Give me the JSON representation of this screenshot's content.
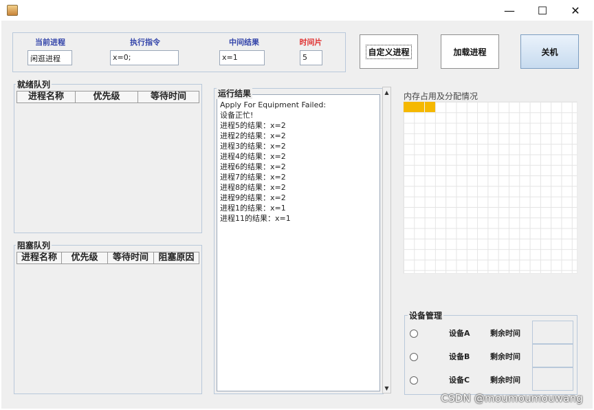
{
  "window": {
    "minimize_symbol": "—",
    "maximize_symbol": "☐",
    "close_symbol": "✕"
  },
  "top": {
    "current_process": {
      "label": "当前进程",
      "value": "闲逛进程"
    },
    "instruction": {
      "label": "执行指令",
      "value": "x=0;"
    },
    "intermediate": {
      "label": "中间结果",
      "value": "x=1"
    },
    "time_slice": {
      "label": "时间片",
      "value": "5"
    }
  },
  "colors": {
    "label_blue": "#3344aa",
    "label_red": "#e03030",
    "memory_used": "#f5b800"
  },
  "buttons": {
    "custom": "自定义进程",
    "load": "加载进程",
    "shutdown": "关机"
  },
  "ready_queue": {
    "title": "就绪队列",
    "columns": [
      "进程名称",
      "优先级",
      "等待时间"
    ]
  },
  "blocked_queue": {
    "title": "阻塞队列",
    "columns": [
      "进程名称",
      "优先级",
      "等待时间",
      "阻塞原因"
    ]
  },
  "run_results": {
    "title": "运行结果",
    "lines": [
      "Apply For Equipment Failed:",
      "设备正忙!",
      "进程5的结果：x=2",
      "进程2的结果：x=2",
      "进程3的结果：x=2",
      "进程4的结果：x=2",
      "进程6的结果：x=2",
      "进程7的结果：x=2",
      "进程8的结果：x=2",
      "进程9的结果：x=2",
      "进程1的结果：x=1",
      "进程11的结果：x=1"
    ]
  },
  "memory": {
    "title": "内存占用及分配情况",
    "used_blocks": 3
  },
  "devices": {
    "title": "设备管理",
    "remaining_label": "剩余时间",
    "items": [
      {
        "name": "设备A"
      },
      {
        "name": "设备B"
      },
      {
        "name": "设备C"
      }
    ]
  },
  "watermark": "CSDN @moumoumouwang"
}
